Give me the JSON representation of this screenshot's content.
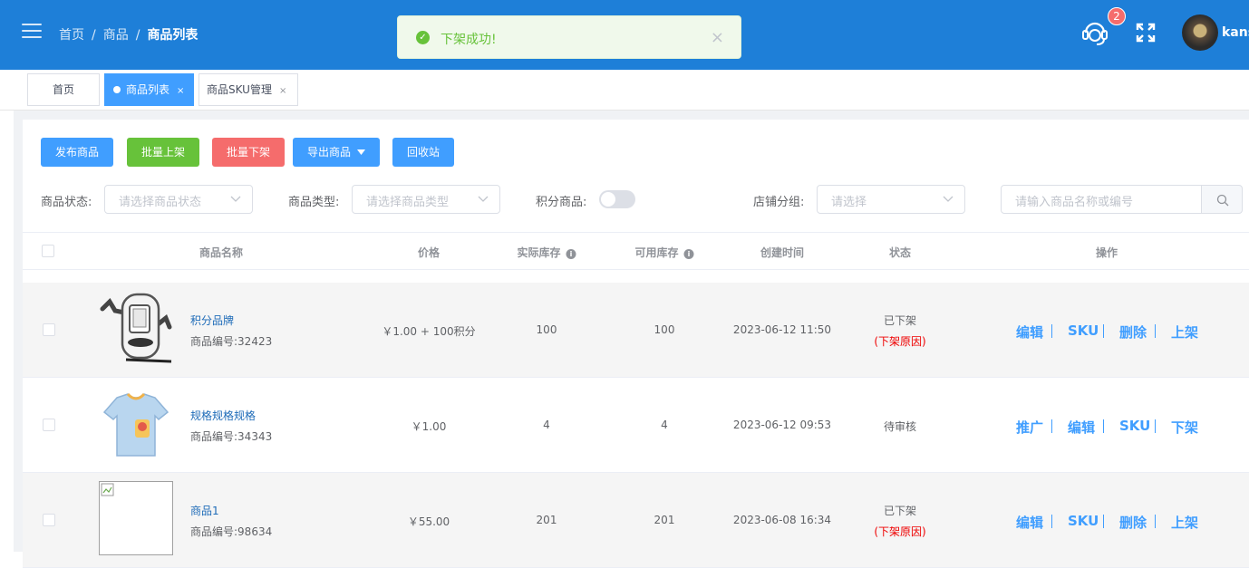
{
  "header": {
    "breadcrumb": [
      "首页",
      "商品",
      "商品列表"
    ],
    "breadcrumb_sep": "/",
    "notification_count": "2",
    "username": "kans"
  },
  "toast": {
    "message": "下架成功!",
    "close": "×",
    "type": "success"
  },
  "tabs": [
    {
      "label": "首页",
      "active": false,
      "closable": false
    },
    {
      "label": "商品列表",
      "active": true,
      "closable": true
    },
    {
      "label": "商品SKU管理",
      "active": false,
      "closable": true
    }
  ],
  "tab_close": "×",
  "toolbar": {
    "publish": "发布商品",
    "batch_on": "批量上架",
    "batch_off": "批量下架",
    "export": "导出商品",
    "recycle": "回收站"
  },
  "filters": {
    "status_label": "商品状态:",
    "status_placeholder": "请选择商品状态",
    "type_label": "商品类型:",
    "type_placeholder": "请选择商品类型",
    "points_label": "积分商品:",
    "points_enabled": false,
    "group_label": "店铺分组:",
    "group_placeholder": "请选择",
    "search_placeholder": "请输入商品名称或编号"
  },
  "table": {
    "columns": [
      "商品名称",
      "价格",
      "实际库存",
      "可用库存",
      "创建时间",
      "状态",
      "操作"
    ],
    "rows": [
      {
        "name": "积分品牌",
        "code": "商品编号:32423",
        "price": "￥1.00 + 100积分",
        "actual_stock": "100",
        "available_stock": "100",
        "created": "2023-06-12 11:50",
        "status": "已下架",
        "reason": "(下架原因)",
        "actions": [
          "编辑",
          "SKU",
          "删除",
          "上架"
        ]
      },
      {
        "name": "规格规格规格",
        "code": "商品编号:34343",
        "price": "￥1.00",
        "actual_stock": "4",
        "available_stock": "4",
        "created": "2023-06-12 09:53",
        "status": "待审核",
        "reason": "",
        "actions": [
          "推广",
          "编辑",
          "SKU",
          "下架"
        ]
      },
      {
        "name": "商品1",
        "code": "商品编号:98634",
        "price": "￥55.00",
        "actual_stock": "201",
        "available_stock": "201",
        "created": "2023-06-08 16:34",
        "status": "已下架",
        "reason": "(下架原因)",
        "actions": [
          "编辑",
          "SKU",
          "删除",
          "上架"
        ]
      }
    ]
  },
  "colors": {
    "header": "#1e7fd8",
    "primary": "#409eff",
    "success": "#67c23a",
    "danger": "#f56c6c"
  }
}
